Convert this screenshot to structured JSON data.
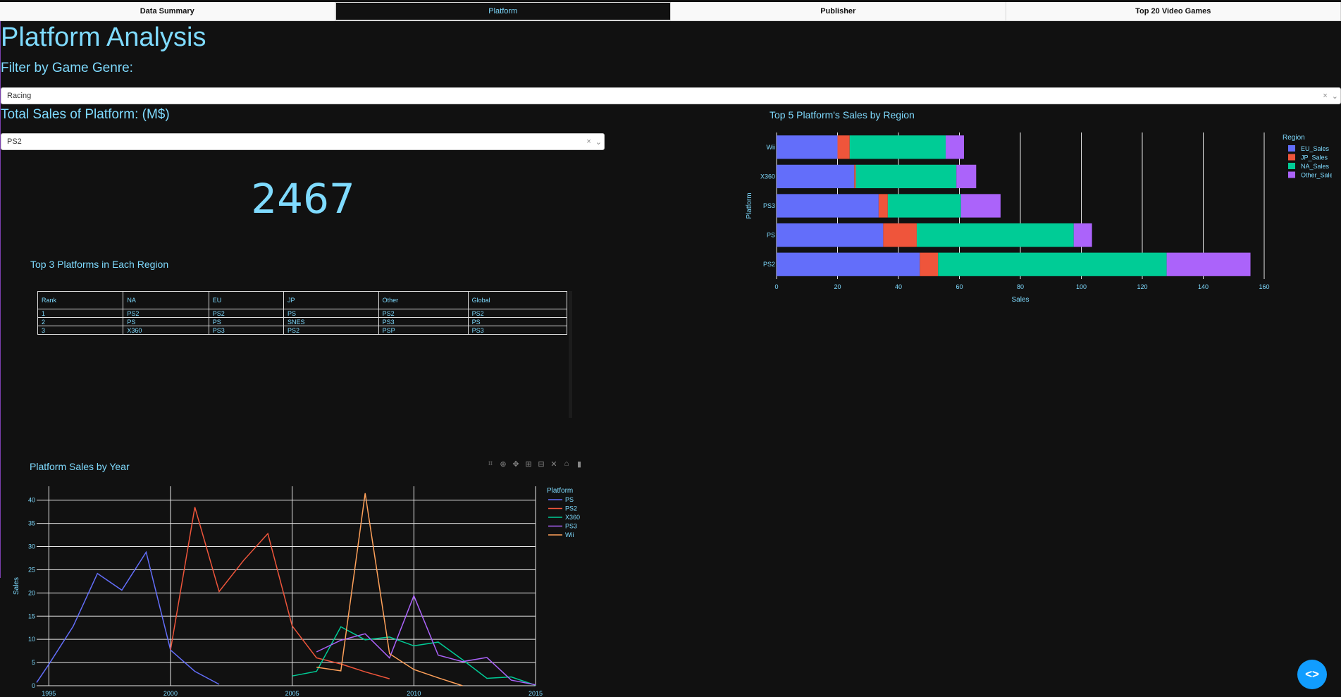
{
  "tabs": [
    {
      "label": "Data Summary"
    },
    {
      "label": "Platform"
    },
    {
      "label": "Publisher"
    },
    {
      "label": "Top 20 Video Games"
    }
  ],
  "page_title": "Platform Analysis",
  "genre_filter": {
    "label": "Filter by Game Genre:",
    "value": "Racing"
  },
  "total_sales": {
    "label": "Total Sales of Platform: (M$)",
    "platform_value": "PS2",
    "value": "2467"
  },
  "region_table": {
    "title": "Top 3 Platforms in Each Region",
    "headers": [
      "Rank",
      "NA",
      "EU",
      "JP",
      "Other",
      "Global"
    ],
    "rows": [
      [
        "1",
        "PS2",
        "PS2",
        "PS",
        "PS2",
        "PS2"
      ],
      [
        "2",
        "PS",
        "PS",
        "SNES",
        "PS3",
        "PS"
      ],
      [
        "3",
        "X360",
        "PS3",
        "PS2",
        "PSP",
        "PS3"
      ]
    ]
  },
  "modebar_icons": [
    "camera-icon",
    "zoom-icon",
    "pan-icon",
    "zoom-in-icon",
    "zoom-out-icon",
    "autoscale-icon",
    "reset-axes-icon",
    "plotly-logo-icon"
  ],
  "colors": {
    "accent": "#7FDBFF",
    "background": "#111111",
    "fab": "#119DFF"
  },
  "chart_data": [
    {
      "type": "bar",
      "orientation": "horizontal",
      "stacked": true,
      "title": "Top 5 Platform's Sales by Region",
      "xlabel": "Sales",
      "ylabel": "Platform",
      "xlim": [
        0,
        160
      ],
      "xticks": [
        0,
        20,
        40,
        60,
        80,
        100,
        120,
        140,
        160
      ],
      "legend_title": "Region",
      "legend_position": "right",
      "categories": [
        "Wii",
        "X360",
        "PS3",
        "PS",
        "PS2"
      ],
      "series": [
        {
          "name": "EU_Sales",
          "color": "#636EFA",
          "values": [
            20,
            25.5,
            33.5,
            35,
            47
          ]
        },
        {
          "name": "JP_Sales",
          "color": "#EF553B",
          "values": [
            4,
            0.5,
            3,
            11,
            6
          ]
        },
        {
          "name": "NA_Sales",
          "color": "#00CC96",
          "values": [
            31.5,
            33,
            24,
            51.5,
            75
          ]
        },
        {
          "name": "Other_Sales",
          "color": "#AB63FA",
          "values": [
            6,
            6.5,
            13,
            6,
            27.5
          ]
        }
      ]
    },
    {
      "type": "line",
      "title": "Platform Sales by Year",
      "xlabel": "",
      "ylabel": "Sales",
      "xlim": [
        1994.5,
        2015
      ],
      "ylim": [
        0,
        43
      ],
      "xticks": [
        1995,
        2000,
        2005,
        2010,
        2015
      ],
      "yticks": [
        0,
        5,
        10,
        15,
        20,
        25,
        30,
        35,
        40
      ],
      "legend_title": "Platform",
      "legend_position": "right",
      "series": [
        {
          "name": "PS",
          "color": "#636EFA",
          "x": [
            1994.5,
            1995,
            1996,
            1997,
            1998,
            1999,
            2000,
            2001,
            2002
          ],
          "y": [
            0.7,
            4.6,
            12.8,
            24.2,
            20.6,
            28.8,
            7.7,
            3.1,
            0.3
          ]
        },
        {
          "name": "PS2",
          "color": "#EF553B",
          "x": [
            2000,
            2001,
            2002,
            2003,
            2004,
            2005,
            2006,
            2007,
            2008,
            2009
          ],
          "y": [
            7.7,
            38.5,
            20.3,
            27.0,
            32.8,
            12.9,
            6.0,
            4.7,
            3.0,
            1.5
          ]
        },
        {
          "name": "X360",
          "color": "#00CC96",
          "x": [
            2005,
            2006,
            2007,
            2008,
            2009,
            2010,
            2011,
            2012,
            2013,
            2014,
            2015
          ],
          "y": [
            2.1,
            3.1,
            12.7,
            9.9,
            10.5,
            8.6,
            9.4,
            5.6,
            1.6,
            1.9,
            0.1
          ]
        },
        {
          "name": "PS3",
          "color": "#AB63FA",
          "x": [
            2006,
            2007,
            2008,
            2009,
            2010,
            2011,
            2012,
            2013,
            2014,
            2015
          ],
          "y": [
            7.3,
            9.8,
            11.2,
            6.0,
            19.4,
            6.6,
            5.2,
            6.1,
            1.2,
            0.2
          ]
        },
        {
          "name": "Wii",
          "color": "#FFA15A",
          "x": [
            2006,
            2007,
            2008,
            2009,
            2010,
            2011,
            2012
          ],
          "y": [
            4.0,
            3.2,
            41.5,
            6.9,
            3.5,
            1.7,
            0.0
          ]
        }
      ]
    }
  ]
}
